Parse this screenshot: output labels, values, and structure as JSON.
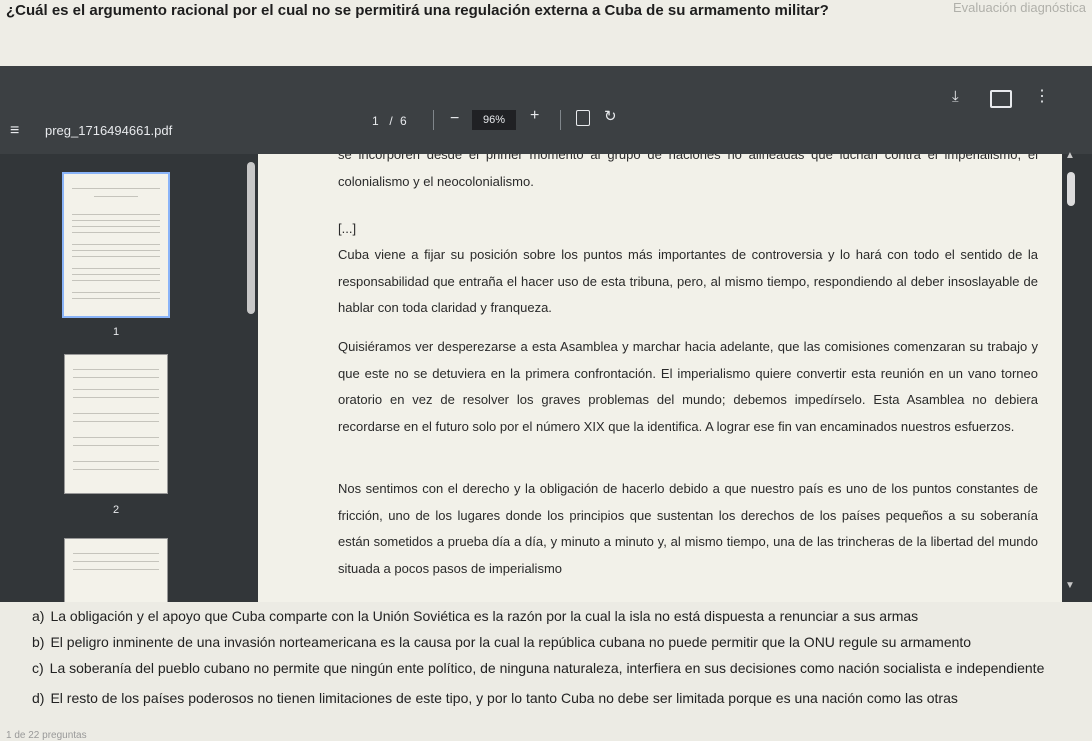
{
  "question": "¿Cuál es el argumento racional por el cual no se permitirá una regulación externa a Cuba de su armamento militar?",
  "top_right_text": "Evaluación diagnóstica",
  "pdf_toolbar": {
    "filename": "preg_1716494661.pdf",
    "current_page": "1",
    "page_separator": "/",
    "total_pages": "6",
    "zoom": "96%"
  },
  "thumbnails": [
    {
      "label": "1"
    },
    {
      "label": "2"
    }
  ],
  "document": {
    "paragraphs": [
      "se incorporen desde el primer momento al grupo de naciones no alineadas que luchan contra el imperialismo, el colonialismo y el neocolonialismo.",
      "[...]",
      "Cuba viene a fijar su posición sobre los puntos más importantes de controversia y lo hará con todo el sentido de la responsabilidad que entraña el hacer uso de esta tribuna, pero, al mismo tiempo, respondiendo al deber insoslayable de hablar con toda claridad y franqueza.",
      "Quisiéramos ver desperezarse a esta Asamblea y marchar hacia adelante, que las comisiones comenzaran su trabajo y que este no se detuviera en la primera confrontación. El imperialismo quiere convertir esta reunión en un vano torneo oratorio en vez de resolver los graves problemas del mundo; debemos impedírselo. Esta Asamblea no debiera recordarse en el futuro solo por el número XIX que la identifica. A lograr ese fin van encaminados nuestros esfuerzos.",
      "Nos sentimos con el derecho y la obligación de hacerlo debido a que nuestro país es uno de los puntos constantes de fricción, uno de los lugares donde los principios que sustentan los derechos de los países pequeños a su soberanía están sometidos a prueba día a día, y minuto a minuto y, al mismo tiempo, una de las trincheras de la libertad del mundo situada a pocos pasos de imperialismo"
    ]
  },
  "options": [
    {
      "letter": "a)",
      "text": "La obligación y el apoyo que Cuba comparte con la Unión Soviética es la razón por la cual la isla no está dispuesta a renunciar a sus armas"
    },
    {
      "letter": "b)",
      "text": "El peligro inminente de una invasión norteamericana es la causa por la cual la república cubana no puede permitir que la ONU regule su armamento"
    },
    {
      "letter": "c)",
      "text": "La soberanía del pueblo cubano no permite que ningún ente político, de ninguna naturaleza, interfiera en sus decisiones como nación socialista e independiente"
    },
    {
      "letter": "d)",
      "text": "El resto de los países poderosos no tienen limitaciones de este tipo, y por lo tanto Cuba no debe ser limitada porque es una nación como las otras"
    }
  ],
  "footer_note": "1 de 22 preguntas"
}
